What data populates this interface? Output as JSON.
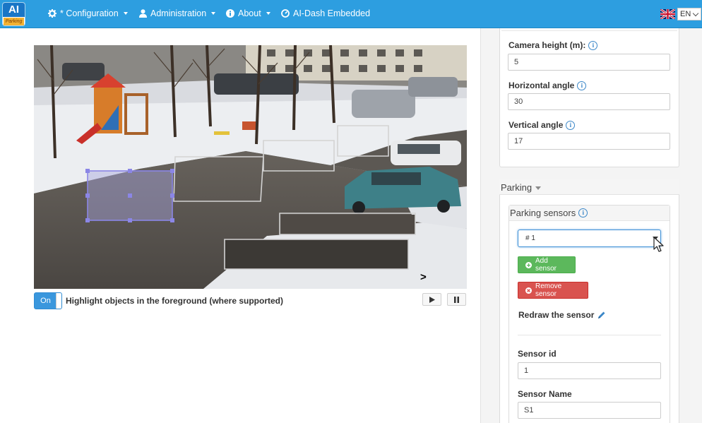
{
  "nav": {
    "logo_text": "AI",
    "logo_sub": "Parking",
    "configuration": "* Configuration",
    "administration": "Administration",
    "about": "About",
    "dash": "AI-Dash Embedded",
    "language": "EN"
  },
  "video": {
    "toggle_label": "On",
    "highlight_text": "Highlight objects in the foreground (where supported)",
    "cursor_glyph": ">"
  },
  "camera": {
    "height_label": "Camera height (m):",
    "height_value": "5",
    "horizontal_label": "Horizontal angle",
    "horizontal_value": "30",
    "vertical_label": "Vertical angle",
    "vertical_value": "17"
  },
  "parking": {
    "title": "Parking",
    "sensors_title": "Parking sensors",
    "selected_sensor": "# 1",
    "add_button": "Add sensor",
    "remove_button": "Remove sensor",
    "redraw_label": "Redraw the sensor",
    "sensor_id_label": "Sensor id",
    "sensor_id_value": "1",
    "sensor_name_label": "Sensor Name",
    "sensor_name_value": "S1"
  },
  "colors": {
    "navbar": "#2d9ee0",
    "accent_blue": "#3a97dd",
    "success": "#5cb85c",
    "danger": "#d9534f",
    "selection": "#8b86e6"
  }
}
